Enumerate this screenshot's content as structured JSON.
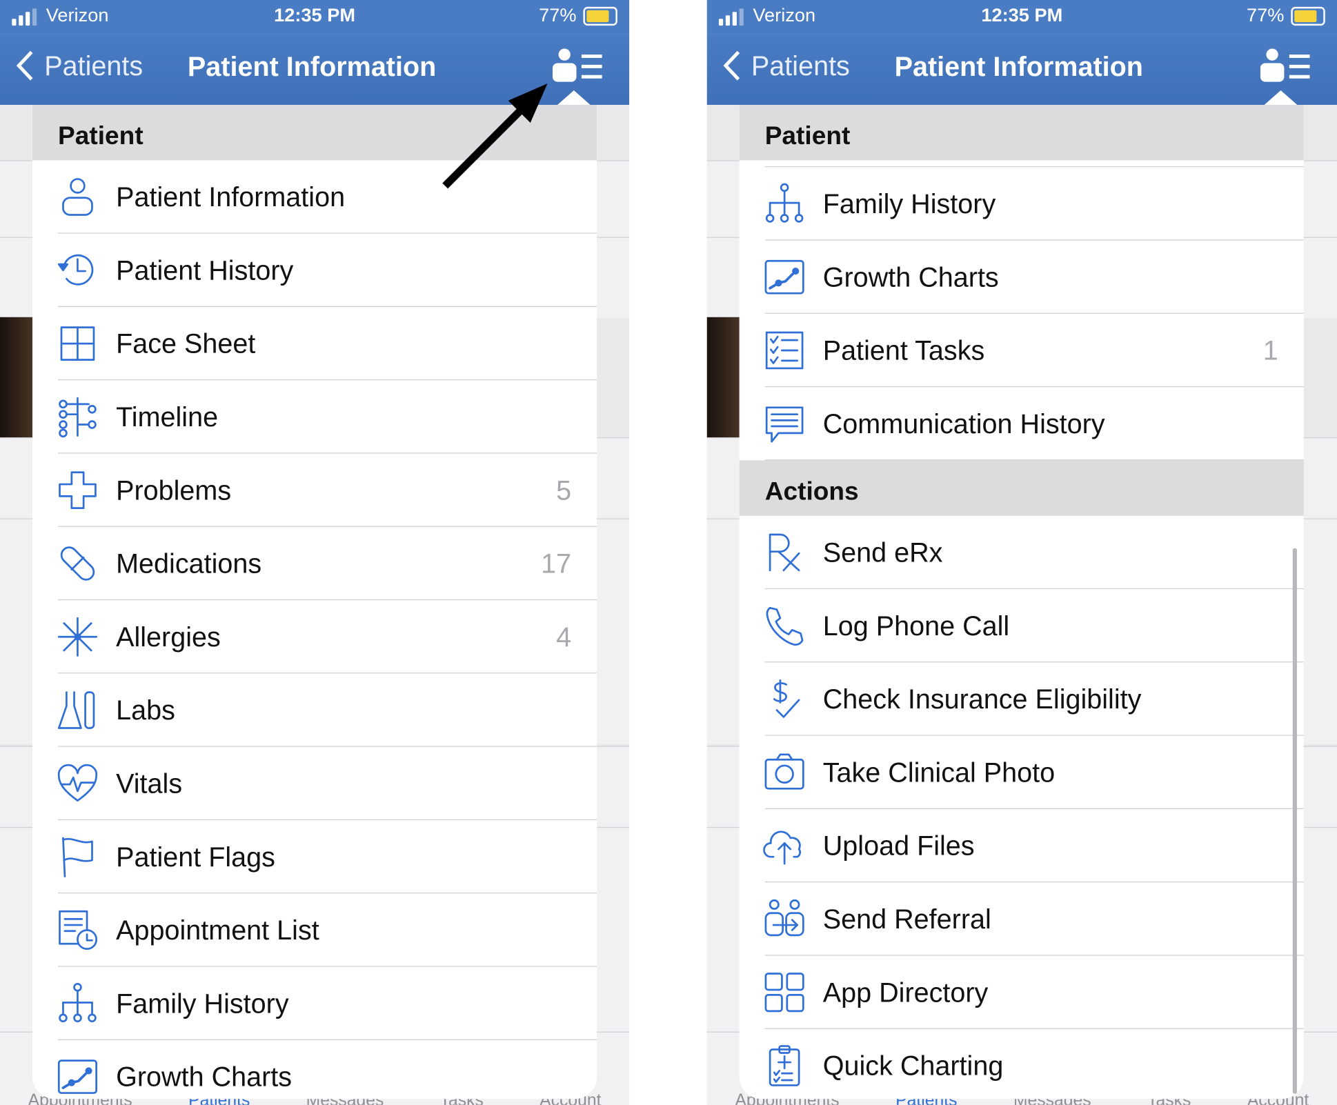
{
  "status": {
    "carrier": "Verizon",
    "time": "12:35 PM",
    "battery": "77%"
  },
  "nav": {
    "back": "Patients",
    "title": "Patient Information"
  },
  "tabs": [
    "Appointments",
    "Patients",
    "Messages",
    "Tasks",
    "Account"
  ],
  "accent": "#2f6fd6",
  "left": {
    "sections": [
      {
        "title": "Patient",
        "items": [
          {
            "label": "Patient Information",
            "icon": "person"
          },
          {
            "label": "Patient History",
            "icon": "history"
          },
          {
            "label": "Face Sheet",
            "icon": "grid"
          },
          {
            "label": "Timeline",
            "icon": "timeline"
          },
          {
            "label": "Problems",
            "icon": "cross",
            "count": "5"
          },
          {
            "label": "Medications",
            "icon": "pill",
            "count": "17"
          },
          {
            "label": "Allergies",
            "icon": "burst",
            "count": "4"
          },
          {
            "label": "Labs",
            "icon": "flask"
          },
          {
            "label": "Vitals",
            "icon": "heart"
          },
          {
            "label": "Patient Flags",
            "icon": "flag"
          },
          {
            "label": "Appointment List",
            "icon": "appointment"
          },
          {
            "label": "Family History",
            "icon": "tree"
          },
          {
            "label": "Growth Charts",
            "icon": "chart"
          }
        ]
      }
    ]
  },
  "right": {
    "sections": [
      {
        "title": "Patient",
        "items": [
          {
            "label": "Family History",
            "icon": "tree"
          },
          {
            "label": "Growth Charts",
            "icon": "chart"
          },
          {
            "label": "Patient Tasks",
            "icon": "tasks",
            "count": "1"
          },
          {
            "label": "Communication History",
            "icon": "message"
          }
        ]
      },
      {
        "title": "Actions",
        "items": [
          {
            "label": "Send eRx",
            "icon": "rx"
          },
          {
            "label": "Log Phone Call",
            "icon": "phone"
          },
          {
            "label": "Check Insurance Eligibility",
            "icon": "dollar"
          },
          {
            "label": "Take Clinical Photo",
            "icon": "camera"
          },
          {
            "label": "Upload Files",
            "icon": "cloud"
          },
          {
            "label": "Send Referral",
            "icon": "referral"
          },
          {
            "label": "App Directory",
            "icon": "apps"
          },
          {
            "label": "Quick Charting",
            "icon": "clipboard"
          }
        ]
      }
    ]
  }
}
